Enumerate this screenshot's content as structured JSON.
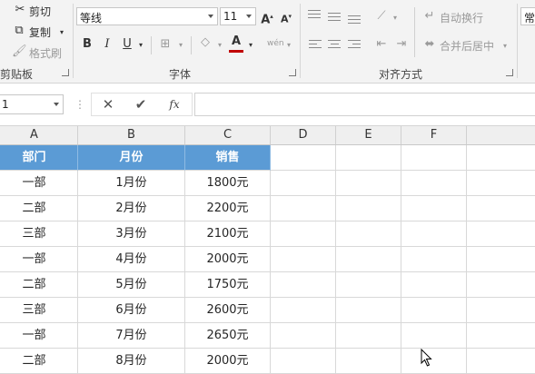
{
  "clipboard": {
    "cut": "剪切",
    "copy": "复制",
    "format_painter": "格式刷",
    "group_label": "剪贴板"
  },
  "font": {
    "name": "等线",
    "size": "11",
    "group_label": "字体",
    "bold": "B",
    "italic": "I",
    "underline": "U"
  },
  "alignment": {
    "wrap_text": "自动换行",
    "merge_center": "合并后居中",
    "group_label": "对齐方式"
  },
  "number": {
    "format": "常"
  },
  "formula_bar": {
    "name_box": "1",
    "fx": "fx",
    "value": ""
  },
  "columns": [
    "A",
    "B",
    "C",
    "D",
    "E",
    "F"
  ],
  "table": {
    "headers": [
      "部门",
      "月份",
      "销售"
    ],
    "rows": [
      [
        "一部",
        "1月份",
        "1800元"
      ],
      [
        "二部",
        "2月份",
        "2200元"
      ],
      [
        "三部",
        "3月份",
        "2100元"
      ],
      [
        "一部",
        "4月份",
        "2000元"
      ],
      [
        "二部",
        "5月份",
        "1750元"
      ],
      [
        "三部",
        "6月份",
        "2600元"
      ],
      [
        "一部",
        "7月份",
        "2650元"
      ],
      [
        "二部",
        "8月份",
        "2000元"
      ]
    ]
  },
  "colors": {
    "header_fill": "#5b9bd5",
    "font_color_bar": "#c00000"
  }
}
